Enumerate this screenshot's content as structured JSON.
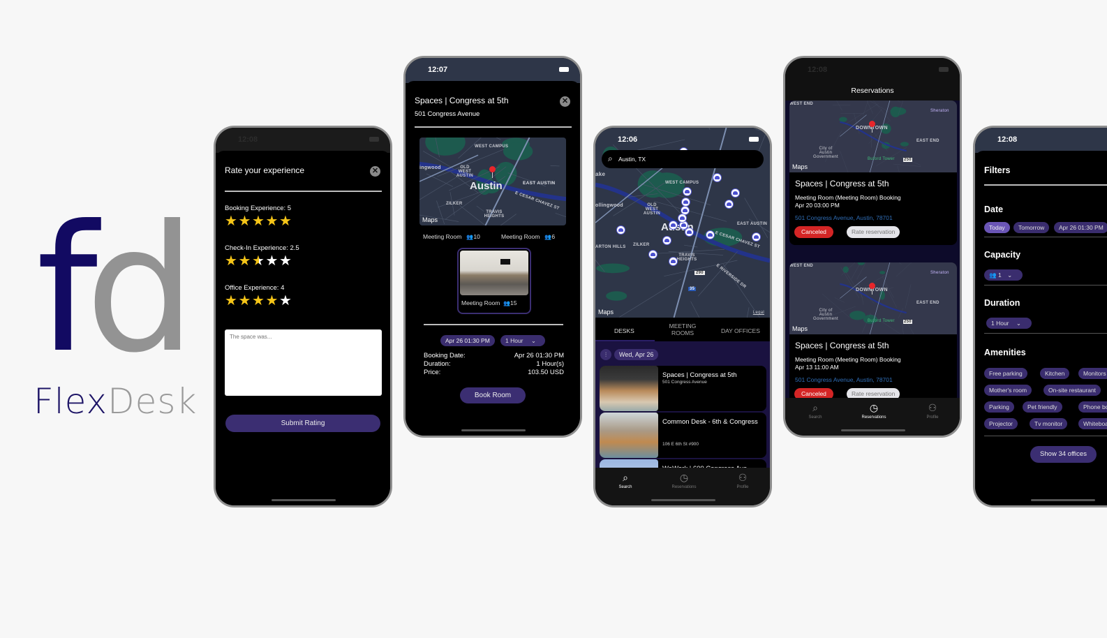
{
  "brand": {
    "logo_f": "f",
    "logo_d": "d",
    "name_part1": "Flex",
    "name_part2": "Desk",
    "colors": {
      "navy": "#120a62",
      "gray": "#939393"
    }
  },
  "rate_screen": {
    "time": "12:08",
    "title": "Rate your experience",
    "close_icon": "close-circle-icon",
    "ratings": [
      {
        "label": "Booking Experience: 5",
        "value": 5
      },
      {
        "label": "Check-In Experience: 2.5",
        "value": 2.5
      },
      {
        "label": "Office Experience: 4",
        "value": 4
      }
    ],
    "comment_placeholder": "The space was...",
    "submit_label": "Submit Rating"
  },
  "room_screen": {
    "time": "12:07",
    "title": "Spaces | Congress at 5th",
    "address": "501 Congress Avenue",
    "map_labels": {
      "city": "Austin",
      "a": "WEST CAMPUS",
      "b": "OLD WEST AUSTIN",
      "c": "EAST AUSTIN",
      "d": "ZILKER",
      "e": "TRAVIS HEIGHTS",
      "f": "ingwood",
      "g": "E CESAR CHAVEZ ST",
      "maps": "Maps"
    },
    "rooms": [
      {
        "name": "Meeting Room",
        "capacity": "10"
      },
      {
        "name": "Meeting Room",
        "capacity": "6"
      },
      {
        "name": "Meeting Room",
        "capacity": "15",
        "selected": true
      }
    ],
    "date_chip": "Apr 26 01:30 PM",
    "duration_chip": "1 Hour",
    "details": [
      {
        "label": "Booking Date:",
        "value": "Apr 26 01:30 PM"
      },
      {
        "label": "Duration:",
        "value": "1 Hour(s)"
      },
      {
        "label": "Price:",
        "value": "103.50 USD"
      }
    ],
    "book_label": "Book Room"
  },
  "search_screen": {
    "time": "12:06",
    "search_value": "Austin, TX",
    "map_labels": {
      "city": "Austin",
      "a": "WEST CAMPUS",
      "b": "OLD WEST AUSTIN",
      "c": "EAST AUSTIN",
      "d": "ZILKER",
      "e": "TRAVIS HEIGHTS",
      "f": "ollingwood",
      "g": "ARTON HILLS",
      "h": "ake",
      "i": "E CESAR CHAVEZ ST",
      "j": "E RIVERSIDE DR",
      "k": "290",
      "l": "35",
      "maps": "Maps",
      "legal": "Legal"
    },
    "tabs": [
      {
        "label": "DESKS",
        "active": true
      },
      {
        "label": "MEETING ROOMS"
      },
      {
        "label": "DAY OFFICES"
      }
    ],
    "date_chip": "Wed, Apr 26",
    "listings": [
      {
        "name": "Spaces | Congress at 5th",
        "address": "501 Congress Avenue"
      },
      {
        "name": "Common Desk - 6th & Congress",
        "address": "106 E 6th St #900"
      },
      {
        "name": "WeWork | 600 Congress Ave",
        "address": ""
      }
    ],
    "nav": [
      {
        "label": "Search",
        "icon": "search-icon",
        "active": true
      },
      {
        "label": "Reservations",
        "icon": "clock-icon"
      },
      {
        "label": "Profile",
        "icon": "person-icon"
      }
    ]
  },
  "reservations_screen": {
    "time": "12:08",
    "title": "Reservations",
    "map_labels": {
      "a": "WEST END",
      "b": "DOWNTOWN",
      "c": "EAST END",
      "d": "City of Austin Government",
      "e": "Buford Tower",
      "f": "Sheraton",
      "g": "250",
      "maps": "Maps"
    },
    "items": [
      {
        "name": "Spaces | Congress at 5th",
        "type": "Meeting Room (Meeting Room) Booking",
        "date": "Apr 20 03:00 PM",
        "address": "501 Congress Avenue, Austin, 78701",
        "status": "Canceled",
        "action": "Rate reservation"
      },
      {
        "name": "Spaces | Congress at 5th",
        "type": "Meeting Room (Meeting Room) Booking",
        "date": "Apr 13 11:00 AM",
        "address": "501 Congress Avenue, Austin, 78701",
        "status": "Canceled",
        "action": "Rate reservation"
      }
    ],
    "nav": [
      {
        "label": "Search",
        "icon": "search-icon"
      },
      {
        "label": "Reservations",
        "icon": "clock-icon",
        "active": true
      },
      {
        "label": "Profile",
        "icon": "person-icon"
      }
    ]
  },
  "filters_screen": {
    "time": "12:08",
    "title": "Filters",
    "date_label": "Date",
    "date_options": [
      "Today",
      "Tomorrow",
      "Apr 26 01:30 PM"
    ],
    "date_selected": "Today",
    "capacity_label": "Capacity",
    "capacity_value": "1",
    "duration_label": "Duration",
    "duration_value": "1 Hour",
    "amenities_label": "Amenities",
    "amenities": [
      [
        "Free parking",
        "Kitchen",
        "Monitors"
      ],
      [
        "Mother's room",
        "On-site restaurant"
      ],
      [
        "Parking",
        "Pet friendly",
        "Phone booth"
      ],
      [
        "Projector",
        "Tv monitor",
        "Whiteboard"
      ]
    ],
    "show_label": "Show 34 offices"
  },
  "colors": {
    "accent": "#3b2e72",
    "selected_chip": "#6a55b5",
    "star": "#f5c518",
    "canceled": "#d42525",
    "link": "#2f6db5"
  }
}
